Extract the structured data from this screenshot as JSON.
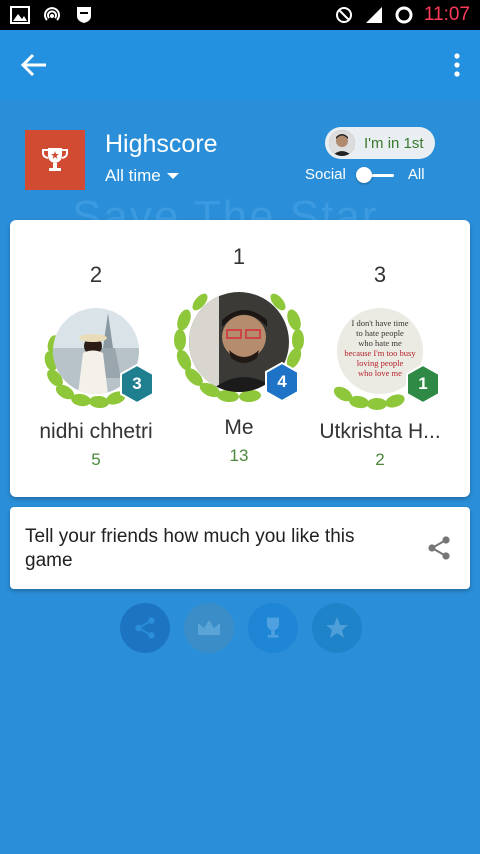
{
  "status_bar": {
    "time": "11:07",
    "left_icons": [
      "image-icon",
      "hotspot-icon",
      "shield-icon"
    ],
    "right_icons": [
      "blocked-icon",
      "signal-icon",
      "sync-icon"
    ]
  },
  "app_bar": {
    "back_icon": "arrow-left-icon",
    "menu_icon": "more-vert-icon"
  },
  "header": {
    "title": "Highscore",
    "period": "All time",
    "my_rank_label": "I'm in 1st",
    "toggle_left": "Social",
    "toggle_right": "All",
    "background_text": "Save The Star"
  },
  "leaderboard": {
    "players": [
      {
        "rank": "2",
        "name": "nidhi chhetri",
        "score": "5",
        "level": "3"
      },
      {
        "rank": "1",
        "name": "Me",
        "score": "13",
        "level": "4"
      },
      {
        "rank": "3",
        "name": "Utkrishta H...",
        "score": "2",
        "level": "1"
      }
    ],
    "avatar_3_text": "I don't have time to hate people who hate me because I'm too busy loving people who love me"
  },
  "share_card": {
    "text": "Tell your friends how much you like this game",
    "icon": "share-icon"
  },
  "colors": {
    "primary": "#2390e0",
    "background": "#2a8fd8",
    "badge": "#d14b33",
    "score_green": "#4a8a3a",
    "hex_teal": "#1f7f8f",
    "hex_blue": "#1e73c7",
    "hex_green": "#2e8a44",
    "time_pink": "#ff3b5c"
  }
}
